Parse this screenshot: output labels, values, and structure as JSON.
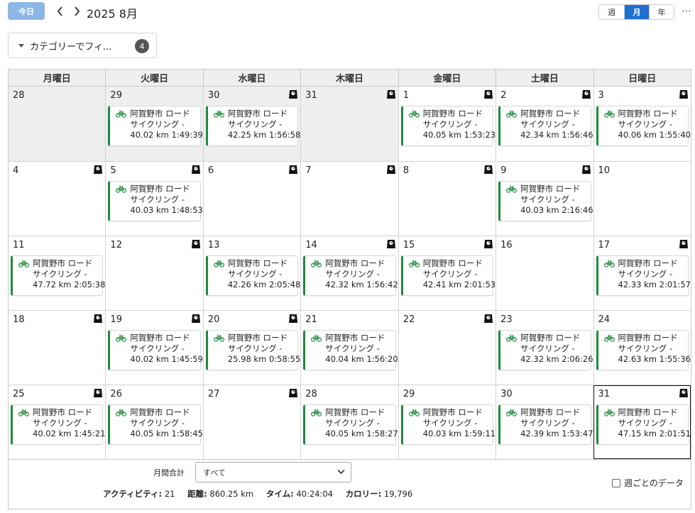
{
  "toolbar": {
    "today_label": "今日",
    "month_title": "2025 8月",
    "views": [
      {
        "label": "週",
        "active": false
      },
      {
        "label": "月",
        "active": true
      },
      {
        "label": "年",
        "active": false
      }
    ],
    "more_label": "⋯"
  },
  "filter": {
    "label": "カテゴリーでフィ...",
    "count": "4"
  },
  "calendar": {
    "weekdays": [
      "月曜日",
      "火曜日",
      "水曜日",
      "木曜日",
      "金曜日",
      "土曜日",
      "日曜日"
    ],
    "accent_color": "#1e8a3c",
    "weeks": [
      [
        {
          "day": "28",
          "other": true,
          "weigh": false,
          "activity": null
        },
        {
          "day": "29",
          "other": true,
          "weigh": false,
          "activity": {
            "line1": "阿賀野市 ロード",
            "line2": "サイクリング -",
            "line3": "40.02 km 1:49:39"
          }
        },
        {
          "day": "30",
          "other": true,
          "weigh": true,
          "activity": {
            "line1": "阿賀野市 ロード",
            "line2": "サイクリング -",
            "line3": "42.25 km 1:56:58"
          }
        },
        {
          "day": "31",
          "other": true,
          "weigh": true,
          "activity": null
        },
        {
          "day": "1",
          "other": false,
          "weigh": true,
          "activity": {
            "line1": "阿賀野市 ロード",
            "line2": "サイクリング -",
            "line3": "40.05 km 1:53:23"
          }
        },
        {
          "day": "2",
          "other": false,
          "weigh": true,
          "activity": {
            "line1": "阿賀野市 ロード",
            "line2": "サイクリング -",
            "line3": "42.34 km 1:56:46"
          }
        },
        {
          "day": "3",
          "other": false,
          "weigh": true,
          "activity": {
            "line1": "阿賀野市 ロード",
            "line2": "サイクリング -",
            "line3": "40.06 km 1:55:40"
          }
        }
      ],
      [
        {
          "day": "4",
          "other": false,
          "weigh": true,
          "activity": null
        },
        {
          "day": "5",
          "other": false,
          "weigh": true,
          "activity": {
            "line1": "阿賀野市 ロード",
            "line2": "サイクリング -",
            "line3": "40.03 km 1:48:53"
          }
        },
        {
          "day": "6",
          "other": false,
          "weigh": true,
          "activity": null
        },
        {
          "day": "7",
          "other": false,
          "weigh": true,
          "activity": null
        },
        {
          "day": "8",
          "other": false,
          "weigh": true,
          "activity": null
        },
        {
          "day": "9",
          "other": false,
          "weigh": true,
          "activity": {
            "line1": "阿賀野市 ロード",
            "line2": "サイクリング -",
            "line3": "40.03 km 2:16:46"
          }
        },
        {
          "day": "10",
          "other": false,
          "weigh": false,
          "activity": null
        }
      ],
      [
        {
          "day": "11",
          "other": false,
          "weigh": false,
          "activity": {
            "line1": "阿賀野市 ロード",
            "line2": "サイクリング -",
            "line3": "47.72 km 2:05:38"
          }
        },
        {
          "day": "12",
          "other": false,
          "weigh": true,
          "activity": null
        },
        {
          "day": "13",
          "other": false,
          "weigh": false,
          "activity": {
            "line1": "阿賀野市 ロード",
            "line2": "サイクリング -",
            "line3": "42.26 km 2:05:48"
          }
        },
        {
          "day": "14",
          "other": false,
          "weigh": true,
          "activity": {
            "line1": "阿賀野市 ロード",
            "line2": "サイクリング -",
            "line3": "42.32 km 1:56:42"
          }
        },
        {
          "day": "15",
          "other": false,
          "weigh": true,
          "activity": {
            "line1": "阿賀野市 ロード",
            "line2": "サイクリング -",
            "line3": "42.41 km 2:01:53"
          }
        },
        {
          "day": "16",
          "other": false,
          "weigh": false,
          "activity": null
        },
        {
          "day": "17",
          "other": false,
          "weigh": true,
          "activity": {
            "line1": "阿賀野市 ロード",
            "line2": "サイクリング -",
            "line3": "42.33 km 2:01:57"
          }
        }
      ],
      [
        {
          "day": "18",
          "other": false,
          "weigh": true,
          "activity": null
        },
        {
          "day": "19",
          "other": false,
          "weigh": true,
          "activity": {
            "line1": "阿賀野市 ロード",
            "line2": "サイクリング -",
            "line3": "40.02 km 1:45:59"
          }
        },
        {
          "day": "20",
          "other": false,
          "weigh": true,
          "activity": {
            "line1": "阿賀野市 ロード",
            "line2": "サイクリング -",
            "line3": "25.98 km 0:58:55"
          }
        },
        {
          "day": "21",
          "other": false,
          "weigh": false,
          "activity": {
            "line1": "阿賀野市 ロード",
            "line2": "サイクリング -",
            "line3": "40.04 km 1:56:20"
          }
        },
        {
          "day": "22",
          "other": false,
          "weigh": true,
          "activity": null
        },
        {
          "day": "23",
          "other": false,
          "weigh": false,
          "activity": {
            "line1": "阿賀野市 ロード",
            "line2": "サイクリング -",
            "line3": "42.32 km 2:06:26"
          }
        },
        {
          "day": "24",
          "other": false,
          "weigh": false,
          "activity": {
            "line1": "阿賀野市 ロード",
            "line2": "サイクリング -",
            "line3": "42.63 km 1:55:36"
          }
        }
      ],
      [
        {
          "day": "25",
          "other": false,
          "weigh": true,
          "activity": {
            "line1": "阿賀野市 ロード",
            "line2": "サイクリング -",
            "line3": "40.02 km 1:45:21"
          }
        },
        {
          "day": "26",
          "other": false,
          "weigh": false,
          "activity": {
            "line1": "阿賀野市 ロード",
            "line2": "サイクリング -",
            "line3": "40.05 km 1:58:45"
          }
        },
        {
          "day": "27",
          "other": false,
          "weigh": true,
          "activity": null
        },
        {
          "day": "28",
          "other": false,
          "weigh": false,
          "activity": {
            "line1": "阿賀野市 ロード",
            "line2": "サイクリング -",
            "line3": "40.05 km 1:58:27"
          }
        },
        {
          "day": "29",
          "other": false,
          "weigh": false,
          "activity": {
            "line1": "阿賀野市 ロード",
            "line2": "サイクリング -",
            "line3": "40.03 km 1:59:11"
          }
        },
        {
          "day": "30",
          "other": false,
          "weigh": false,
          "activity": {
            "line1": "阿賀野市 ロード",
            "line2": "サイクリング -",
            "line3": "42.39 km 1:53:47"
          }
        },
        {
          "day": "31",
          "other": false,
          "weigh": true,
          "selected": true,
          "activity": {
            "line1": "阿賀野市 ロード",
            "line2": "サイクリング -",
            "line3": "47.15 km 2:01:51"
          }
        }
      ]
    ]
  },
  "summary": {
    "label": "月間合計",
    "select_value": "すべて",
    "stats": [
      {
        "label": "アクティビティ:",
        "value": "21"
      },
      {
        "label": "距離:",
        "value": "860.25 km"
      },
      {
        "label": "タイム:",
        "value": "40:24:04"
      },
      {
        "label": "カロリー:",
        "value": "19,796"
      }
    ],
    "weekly_label": "週ごとのデータ"
  }
}
